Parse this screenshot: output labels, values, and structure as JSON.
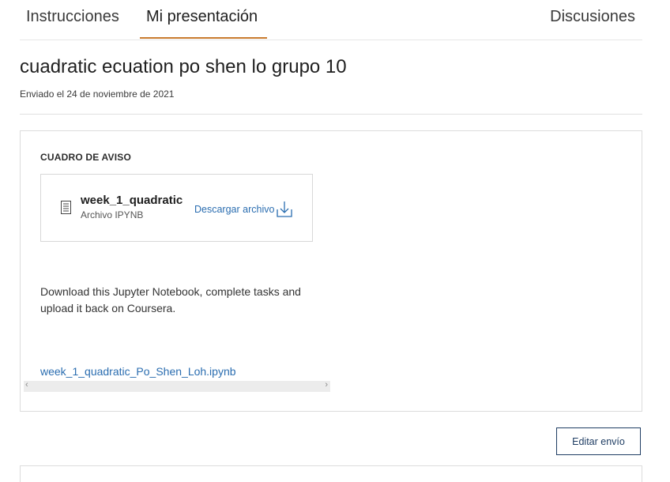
{
  "tabs": [
    {
      "label": "Instrucciones"
    },
    {
      "label": "Mi presentación",
      "active": true
    },
    {
      "label": "Discusiones"
    }
  ],
  "accent_color": "#c97b2e",
  "link_color": "#2a6db0",
  "submission": {
    "title": "cuadratic ecuation po shen lo grupo 10",
    "submitted": "Enviado el 24 de noviembre de 2021"
  },
  "notice": {
    "heading": "CUADRO DE AVISO",
    "file": {
      "name": "week_1_quadratic",
      "type": "Archivo IPYNB",
      "download_label": "Descargar archivo"
    },
    "description": "Download this Jupyter Notebook, complete tasks and upload it back on Coursera.",
    "link_text": "week_1_quadratic_Po_Shen_Loh.ipynb"
  },
  "actions": {
    "edit_label": "Editar envío"
  },
  "icons": {
    "file": "document-icon",
    "download": "download-icon",
    "scroll_left": "chevron-left-icon",
    "scroll_right": "chevron-right-icon"
  }
}
